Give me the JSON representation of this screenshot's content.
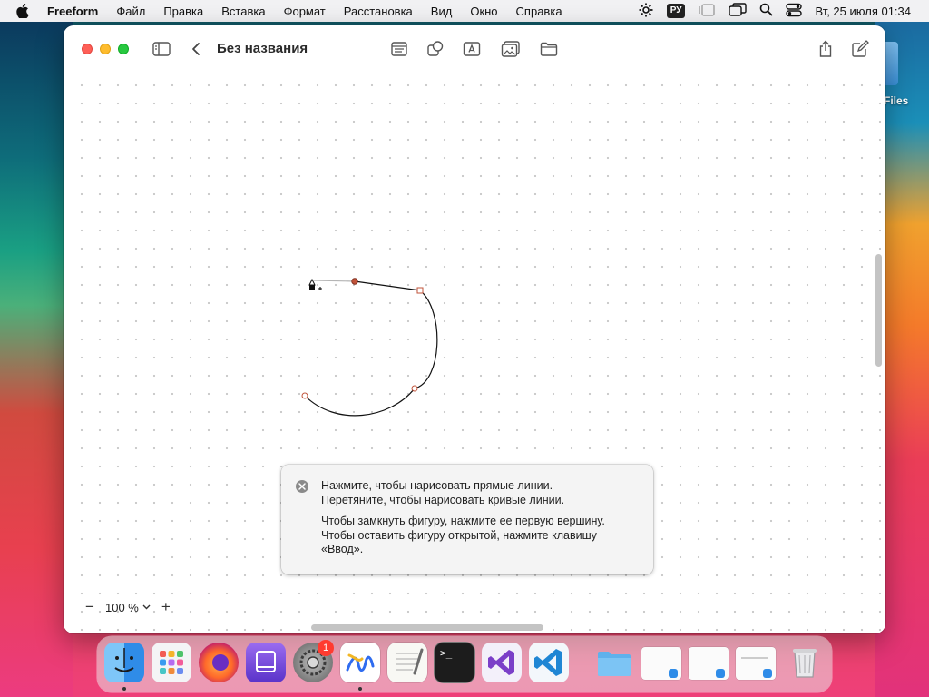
{
  "menubar": {
    "app_name": "Freeform",
    "menus": [
      "Файл",
      "Правка",
      "Вставка",
      "Формат",
      "Расстановка",
      "Вид",
      "Окно",
      "Справка"
    ],
    "keyboard_layout": "РУ",
    "datetime": "Вт, 25 июля  01:34"
  },
  "window": {
    "title": "Без названия"
  },
  "hint": {
    "line1": "Нажмите, чтобы нарисовать прямые линии.",
    "line2": "Перетяните, чтобы нарисовать кривые линии.",
    "line3": "Чтобы замкнуть фигуру, нажмите ее первую вершину.",
    "line4": "Чтобы оставить фигуру открытой, нажмите клавишу",
    "line5": "«Ввод»."
  },
  "zoom": {
    "value": "100 %",
    "minus": "−",
    "plus": "+"
  },
  "desktop": {
    "label": "Files"
  },
  "dock": {
    "settings_badge": "1",
    "terminal_prompt": ">_"
  },
  "colors": {
    "accent_vertex": "#c0533a",
    "stroke": "#111111"
  }
}
